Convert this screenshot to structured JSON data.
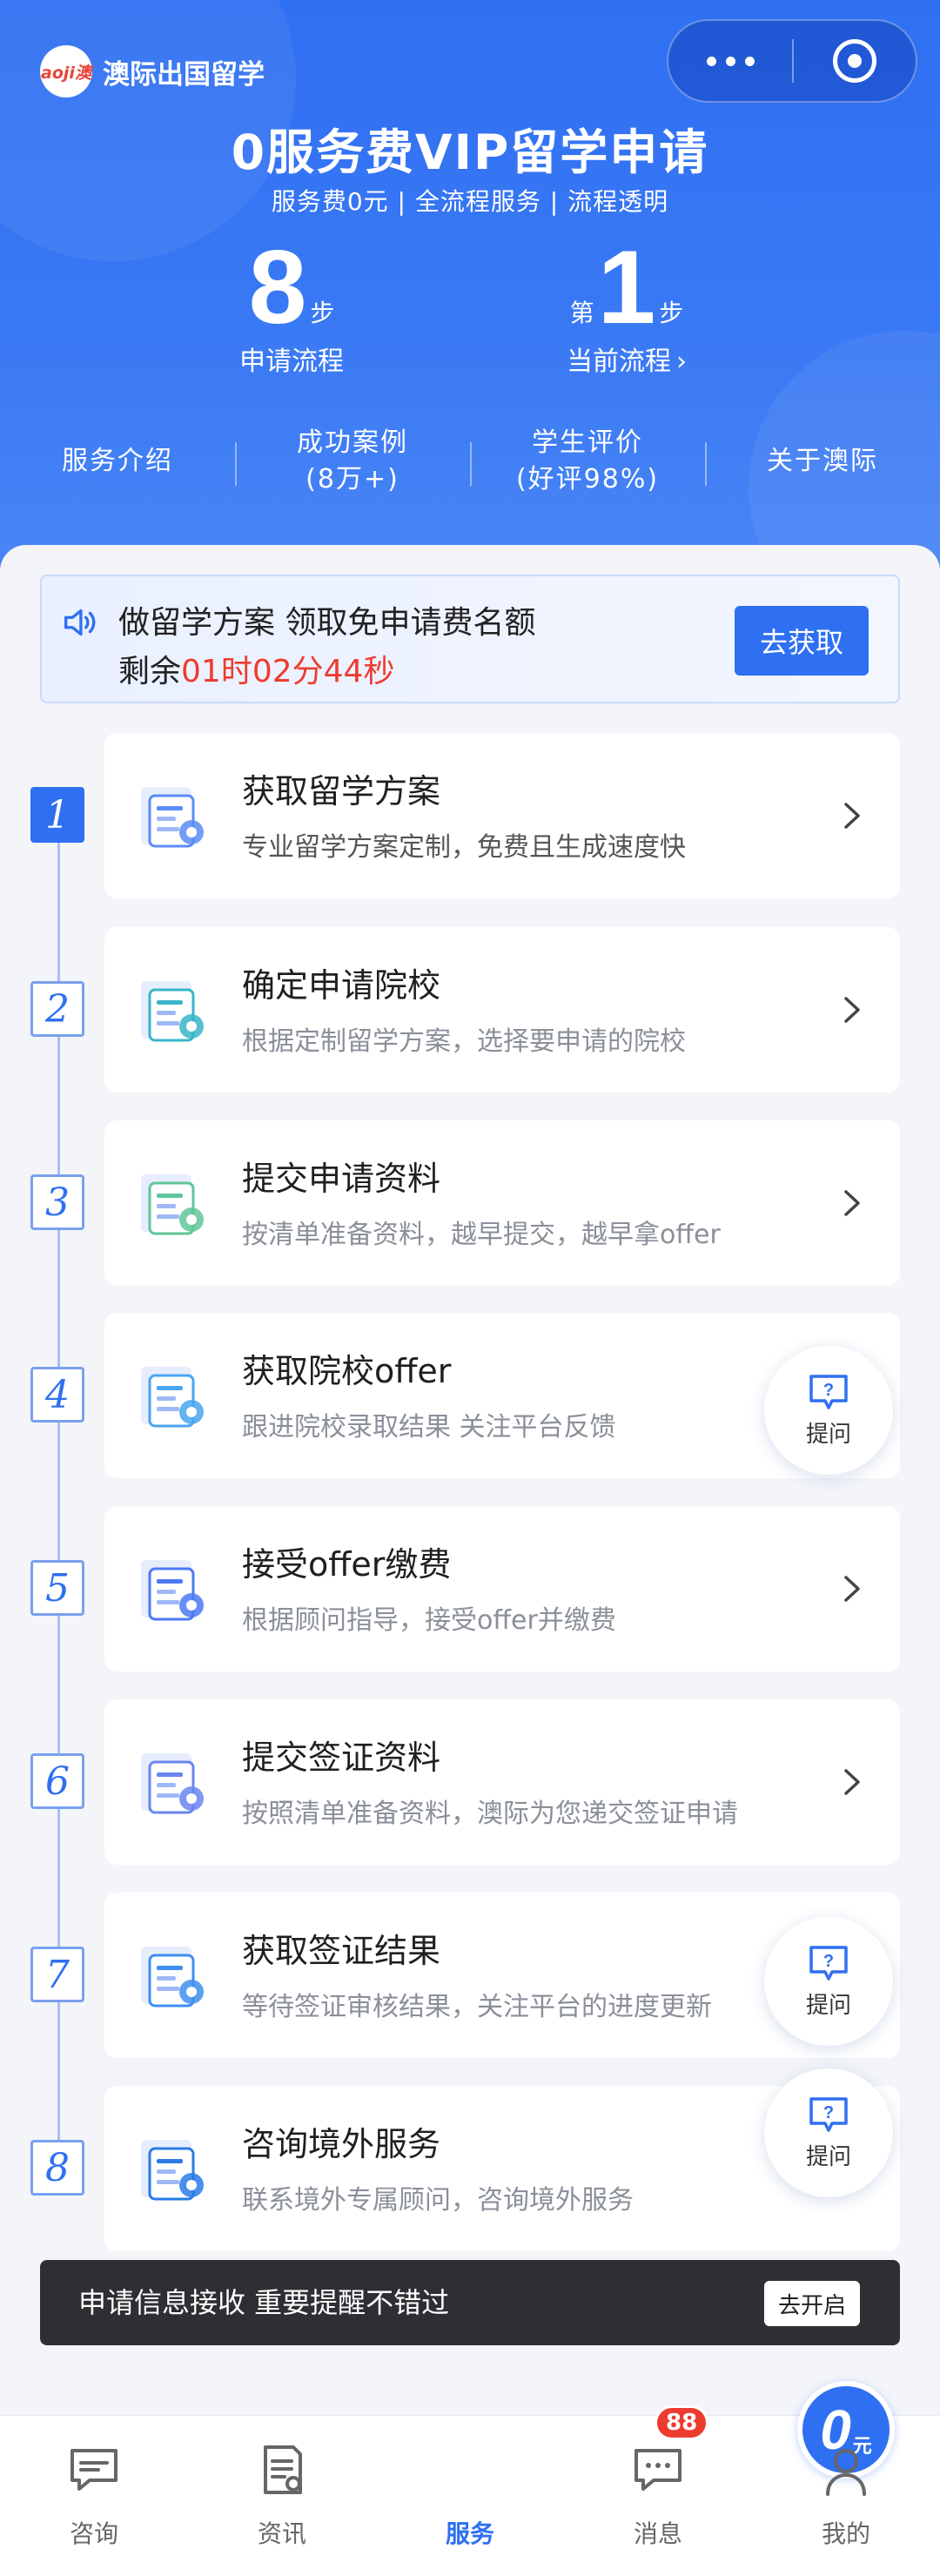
{
  "brand": {
    "name": "澳际出国留学",
    "logo_text": "aoji澳"
  },
  "hero": {
    "title": "0服务费VIP留学申请",
    "subtitle": "服务费0元 | 全流程服务 | 流程透明",
    "stat_steps": {
      "value": "8",
      "unit": "步",
      "caption": "申请流程"
    },
    "stat_current": {
      "prefix": "第",
      "value": "1",
      "unit": "步",
      "caption": "当前流程",
      "chevron": "›"
    },
    "tabs": [
      {
        "label": "服务介绍"
      },
      {
        "label": "成功案例\n(8万+)"
      },
      {
        "label": "学生评价\n(好评98%)"
      },
      {
        "label": "关于澳际"
      }
    ]
  },
  "promo": {
    "line1": "做留学方案 领取免申请费名额",
    "line2_prefix": "剩余",
    "countdown": "01时02分44秒",
    "button": "去获取"
  },
  "steps": [
    {
      "num": "1",
      "title": "获取留学方案",
      "desc": "专业留学方案定制，免费且生成速度快",
      "icon": "plan-icon"
    },
    {
      "num": "2",
      "title": "确定申请院校",
      "desc": "根据定制留学方案，选择要申请的院校",
      "icon": "filter-icon"
    },
    {
      "num": "3",
      "title": "提交申请资料",
      "desc": "按清单准备资料，越早提交，越早拿offer",
      "icon": "document-person-icon"
    },
    {
      "num": "4",
      "title": "获取院校offer",
      "desc": "跟进院校录取结果 关注平台反馈",
      "icon": "shield-document-icon"
    },
    {
      "num": "5",
      "title": "接受offer缴费",
      "desc": "根据顾问指导，接受offer并缴费",
      "icon": "blocks-icon"
    },
    {
      "num": "6",
      "title": "提交签证资料",
      "desc": "按照清单准备资料，澳际为您递交签证申请",
      "icon": "visa-document-icon"
    },
    {
      "num": "7",
      "title": "获取签证结果",
      "desc": "等待签证审核结果，关注平台的进度更新",
      "icon": "magnifier-document-icon"
    },
    {
      "num": "8",
      "title": "咨询境外服务",
      "desc": "联系境外专属顾问，咨询境外服务",
      "icon": "globe-gear-icon"
    }
  ],
  "ask_label": "提问",
  "notice": {
    "text": "申请信息接收 重要提醒不错过",
    "button": "去开启"
  },
  "tabbar": {
    "items": [
      {
        "label": "咨询",
        "icon": "chat-icon"
      },
      {
        "label": "资讯",
        "icon": "news-icon"
      },
      {
        "label": "服务",
        "icon": "zero-fee-icon"
      },
      {
        "label": "消息",
        "icon": "message-icon"
      },
      {
        "label": "我的",
        "icon": "person-icon"
      }
    ],
    "center_zero": "0",
    "center_unit": "元",
    "message_badge": "88"
  },
  "colors": {
    "primary": "#2f6ff2",
    "countdown": "#ee3b2f",
    "notice_bg": "#2d2f33"
  }
}
